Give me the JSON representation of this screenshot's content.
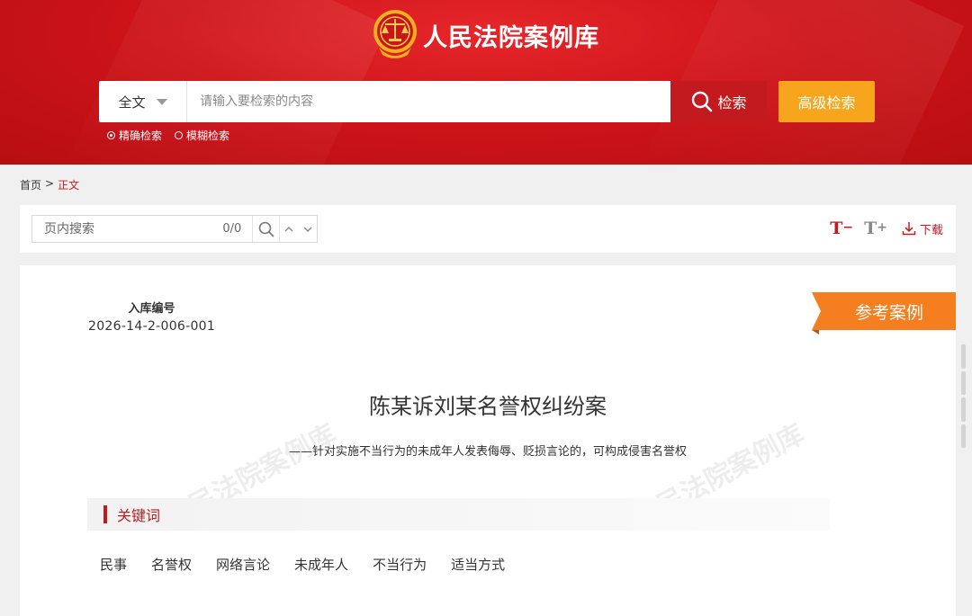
{
  "header": {
    "site_title": "人民法院案例库",
    "search": {
      "scope_label": "全文",
      "placeholder": "请输入要检索的内容",
      "search_button": "检索",
      "advanced_button": "高级检索"
    },
    "modes": [
      {
        "label": "精确检索",
        "selected": true
      },
      {
        "label": "模糊检索",
        "selected": false
      }
    ]
  },
  "breadcrumb": {
    "home": "首页",
    "separator": ">",
    "current": "正文"
  },
  "toolbar": {
    "find_placeholder": "页内搜索",
    "find_count": "0/0",
    "font_decrease": "T",
    "font_decrease_sign": "−",
    "font_increase": "T",
    "font_increase_sign": "+",
    "download_label": "下载"
  },
  "document": {
    "case_number_label": "入库编号",
    "case_number": "2026-14-2-006-001",
    "ribbon_label": "参考案例",
    "title": "陈某诉刘某名誉权纠纷案",
    "subtitle": "——针对实施不当行为的未成年人发表侮辱、贬损言论的，可构成侵害名誉权",
    "watermark": "人民法院案例库",
    "keywords_title": "关键词",
    "keywords": [
      "民事",
      "名誉权",
      "网络言论",
      "未成年人",
      "不当行为",
      "适当方式"
    ]
  },
  "colors": {
    "brand_red": "#c21a1e",
    "accent_orange": "#f7a51c",
    "ribbon_orange": "#f57e20"
  }
}
